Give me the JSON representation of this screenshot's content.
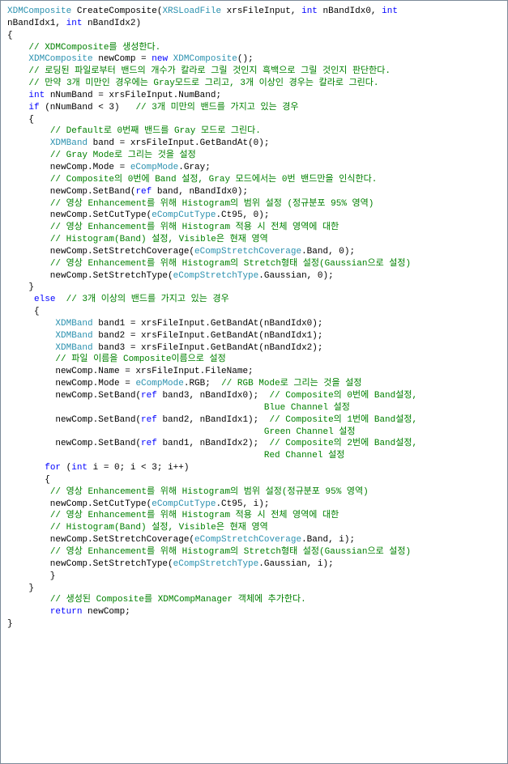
{
  "lines": [
    {
      "indent": 0,
      "parts": [
        {
          "cls": "typ",
          "t": "XDMComposite"
        },
        {
          "t": " CreateComposite("
        },
        {
          "cls": "typ",
          "t": "XRSLoadFile"
        },
        {
          "t": " xrsFileInput, "
        },
        {
          "cls": "kw",
          "t": "int"
        },
        {
          "t": " nBandIdx0, "
        },
        {
          "cls": "kw",
          "t": "int"
        }
      ]
    },
    {
      "indent": 0,
      "parts": [
        {
          "t": "nBandIdx1, "
        },
        {
          "cls": "kw",
          "t": "int"
        },
        {
          "t": " nBandIdx2)"
        }
      ]
    },
    {
      "indent": 0,
      "parts": [
        {
          "t": "{"
        }
      ]
    },
    {
      "indent": 4,
      "parts": [
        {
          "cls": "cmt",
          "t": "// XDMComposite를 생성한다."
        }
      ]
    },
    {
      "indent": 4,
      "parts": [
        {
          "cls": "typ",
          "t": "XDMComposite"
        },
        {
          "t": " newComp = "
        },
        {
          "cls": "kw",
          "t": "new"
        },
        {
          "t": " "
        },
        {
          "cls": "typ",
          "t": "XDMComposite"
        },
        {
          "t": "();"
        }
      ]
    },
    {
      "indent": 0,
      "parts": [
        {
          "t": ""
        }
      ]
    },
    {
      "indent": 4,
      "parts": [
        {
          "cls": "cmt",
          "t": "// 로딩된 파일로부터 밴드의 개수가 칼라로 그릴 것인지 흑백으로 그릴 것인지 판단한다."
        }
      ]
    },
    {
      "indent": 4,
      "parts": [
        {
          "cls": "cmt",
          "t": "// 만약 3개 미만인 경우에는 Gray모드로 그리고, 3개 이상인 경우는 칼라로 그린다."
        }
      ]
    },
    {
      "indent": 4,
      "parts": [
        {
          "cls": "kw",
          "t": "int"
        },
        {
          "t": " nNumBand = xrsFileInput.NumBand;"
        }
      ]
    },
    {
      "indent": 4,
      "parts": [
        {
          "cls": "kw",
          "t": "if"
        },
        {
          "t": " (nNumBand < 3)   "
        },
        {
          "cls": "cmt",
          "t": "// 3개 미만의 밴드를 가지고 있는 경우"
        }
      ]
    },
    {
      "indent": 4,
      "parts": [
        {
          "t": "{"
        }
      ]
    },
    {
      "indent": 8,
      "parts": [
        {
          "cls": "cmt",
          "t": "// Default로 0번째 밴드를 Gray 모드로 그린다."
        }
      ]
    },
    {
      "indent": 8,
      "parts": [
        {
          "cls": "typ",
          "t": "XDMBand"
        },
        {
          "t": " band = xrsFileInput.GetBandAt(0);"
        }
      ]
    },
    {
      "indent": 0,
      "parts": [
        {
          "t": ""
        }
      ]
    },
    {
      "indent": 8,
      "parts": [
        {
          "cls": "cmt",
          "t": "// Gray Mode로 그리는 것을 설정"
        }
      ]
    },
    {
      "indent": 8,
      "parts": [
        {
          "t": "newComp.Mode = "
        },
        {
          "cls": "typ",
          "t": "eCompMode"
        },
        {
          "t": ".Gray;"
        }
      ]
    },
    {
      "indent": 0,
      "parts": [
        {
          "t": ""
        }
      ]
    },
    {
      "indent": 8,
      "parts": [
        {
          "cls": "cmt",
          "t": "// Composite의 0번에 Band 설정, Gray 모드에서는 0번 밴드만을 인식한다."
        }
      ]
    },
    {
      "indent": 8,
      "parts": [
        {
          "t": "newComp.SetBand("
        },
        {
          "cls": "kw",
          "t": "ref"
        },
        {
          "t": " band, nBandIdx0);"
        }
      ]
    },
    {
      "indent": 8,
      "parts": [
        {
          "cls": "cmt",
          "t": "// 영상 Enhancement를 위해 Histogram의 범위 설정 (정규분포 95% 영역)"
        }
      ]
    },
    {
      "indent": 8,
      "parts": [
        {
          "t": "newComp.SetCutType("
        },
        {
          "cls": "typ",
          "t": "eCompCutType"
        },
        {
          "t": ".Ct95, 0);"
        }
      ]
    },
    {
      "indent": 8,
      "parts": [
        {
          "cls": "cmt",
          "t": "// 영상 Enhancement를 위해 Histogram 적용 시 전체 영역에 대한"
        }
      ]
    },
    {
      "indent": 8,
      "parts": [
        {
          "cls": "cmt",
          "t": "// Histogram(Band) 설정, Visible은 현재 영역"
        }
      ]
    },
    {
      "indent": 8,
      "parts": [
        {
          "t": "newComp.SetStretchCoverage("
        },
        {
          "cls": "typ",
          "t": "eCompStretchCoverage"
        },
        {
          "t": ".Band, 0);"
        }
      ]
    },
    {
      "indent": 8,
      "parts": [
        {
          "cls": "cmt",
          "t": "// 영상 Enhancement를 위해 Histogram의 Stretch형태 설정(Gaussian으로 설정)"
        }
      ]
    },
    {
      "indent": 8,
      "parts": [
        {
          "t": "newComp.SetStretchType("
        },
        {
          "cls": "typ",
          "t": "eCompStretchType"
        },
        {
          "t": ".Gaussian, 0);"
        }
      ]
    },
    {
      "indent": 4,
      "parts": [
        {
          "t": "}"
        }
      ]
    },
    {
      "indent": 0,
      "parts": [
        {
          "t": ""
        }
      ]
    },
    {
      "indent": 5,
      "parts": [
        {
          "cls": "kw",
          "t": "else"
        },
        {
          "t": "  "
        },
        {
          "cls": "cmt",
          "t": "// 3개 이상의 밴드를 가지고 있는 경우"
        }
      ]
    },
    {
      "indent": 5,
      "parts": [
        {
          "t": "{"
        }
      ]
    },
    {
      "indent": 9,
      "parts": [
        {
          "cls": "typ",
          "t": "XDMBand"
        },
        {
          "t": " band1 = xrsFileInput.GetBandAt(nBandIdx0);"
        }
      ]
    },
    {
      "indent": 9,
      "parts": [
        {
          "cls": "typ",
          "t": "XDMBand"
        },
        {
          "t": " band2 = xrsFileInput.GetBandAt(nBandIdx1);"
        }
      ]
    },
    {
      "indent": 9,
      "parts": [
        {
          "cls": "typ",
          "t": "XDMBand"
        },
        {
          "t": " band3 = xrsFileInput.GetBandAt(nBandIdx2);"
        }
      ]
    },
    {
      "indent": 9,
      "parts": [
        {
          "cls": "cmt",
          "t": "// 파일 이름을 Composite이름으로 설정"
        }
      ]
    },
    {
      "indent": 9,
      "parts": [
        {
          "t": "newComp.Name = xrsFileInput.FileName;"
        }
      ]
    },
    {
      "indent": 0,
      "parts": [
        {
          "t": ""
        }
      ]
    },
    {
      "indent": 9,
      "parts": [
        {
          "t": "newComp.Mode = "
        },
        {
          "cls": "typ",
          "t": "eCompMode"
        },
        {
          "t": ".RGB;  "
        },
        {
          "cls": "cmt",
          "t": "// RGB Mode로 그리는 것을 설정"
        }
      ]
    },
    {
      "indent": 9,
      "parts": [
        {
          "t": "newComp.SetBand("
        },
        {
          "cls": "kw",
          "t": "ref"
        },
        {
          "t": " band3, nBandIdx0);  "
        },
        {
          "cls": "cmt",
          "t": "// Composite의 0번에 Band설정,"
        }
      ]
    },
    {
      "indent": 48,
      "parts": [
        {
          "cls": "cmt",
          "t": "Blue Channel 설정"
        }
      ]
    },
    {
      "indent": 9,
      "parts": [
        {
          "t": "newComp.SetBand("
        },
        {
          "cls": "kw",
          "t": "ref"
        },
        {
          "t": " band2, nBandIdx1);  "
        },
        {
          "cls": "cmt",
          "t": "// Composite의 1번에 Band설정,"
        }
      ]
    },
    {
      "indent": 48,
      "parts": [
        {
          "cls": "cmt",
          "t": "Green Channel 설정"
        }
      ]
    },
    {
      "indent": 9,
      "parts": [
        {
          "t": "newComp.SetBand("
        },
        {
          "cls": "kw",
          "t": "ref"
        },
        {
          "t": " band1, nBandIdx2);  "
        },
        {
          "cls": "cmt",
          "t": "// Composite의 2번에 Band설정,"
        }
      ]
    },
    {
      "indent": 48,
      "parts": [
        {
          "cls": "cmt",
          "t": "Red Channel 설정"
        }
      ]
    },
    {
      "indent": 0,
      "parts": [
        {
          "t": ""
        }
      ]
    },
    {
      "indent": 7,
      "parts": [
        {
          "cls": "kw",
          "t": "for"
        },
        {
          "t": " ("
        },
        {
          "cls": "kw",
          "t": "int"
        },
        {
          "t": " i = 0; i < 3; i++)"
        }
      ]
    },
    {
      "indent": 7,
      "parts": [
        {
          "t": "{"
        }
      ]
    },
    {
      "indent": 8,
      "parts": [
        {
          "cls": "cmt",
          "t": "// 영상 Enhancement를 위해 Histogram의 범위 설정(정규분포 95% 영역)"
        }
      ]
    },
    {
      "indent": 8,
      "parts": [
        {
          "t": "newComp.SetCutType("
        },
        {
          "cls": "typ",
          "t": "eCompCutType"
        },
        {
          "t": ".Ct95, i);"
        }
      ]
    },
    {
      "indent": 8,
      "parts": [
        {
          "cls": "cmt",
          "t": "// 영상 Enhancement를 위해 Histogram 적용 시 전체 영역에 대한"
        }
      ]
    },
    {
      "indent": 8,
      "parts": [
        {
          "cls": "cmt",
          "t": "// Histogram(Band) 설정, Visible은 현재 영역"
        }
      ]
    },
    {
      "indent": 8,
      "parts": [
        {
          "t": "newComp.SetStretchCoverage("
        },
        {
          "cls": "typ",
          "t": "eCompStretchCoverage"
        },
        {
          "t": ".Band, i);"
        }
      ]
    },
    {
      "indent": 8,
      "parts": [
        {
          "cls": "cmt",
          "t": "// 영상 Enhancement를 위해 Histogram의 Stretch형태 설정(Gaussian으로 설정)"
        }
      ]
    },
    {
      "indent": 8,
      "parts": [
        {
          "t": "newComp.SetStretchType("
        },
        {
          "cls": "typ",
          "t": "eCompStretchType"
        },
        {
          "t": ".Gaussian, i);"
        }
      ]
    },
    {
      "indent": 8,
      "parts": [
        {
          "t": "}"
        }
      ]
    },
    {
      "indent": 4,
      "parts": [
        {
          "t": "}"
        }
      ]
    },
    {
      "indent": 8,
      "parts": [
        {
          "cls": "cmt",
          "t": "// 생성된 Composite를 XDMCompManager 객체에 추가한다."
        }
      ]
    },
    {
      "indent": 8,
      "parts": [
        {
          "cls": "kw",
          "t": "return"
        },
        {
          "t": " newComp;"
        }
      ]
    },
    {
      "indent": 0,
      "parts": [
        {
          "t": "}"
        }
      ]
    }
  ]
}
